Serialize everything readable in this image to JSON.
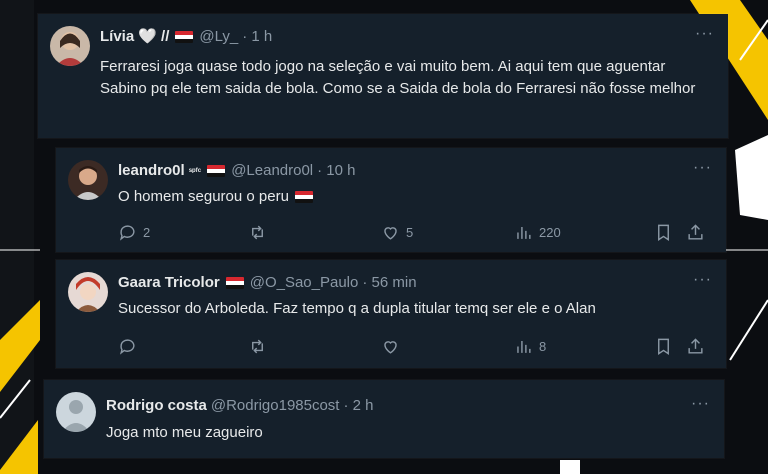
{
  "colors": {
    "card_bg": "#15202b",
    "text": "#e7e9ea",
    "muted": "#8b98a5",
    "accent_yellow": "#f5c400"
  },
  "tweets": [
    {
      "name": "Lívia",
      "name_suffix": "🤍 //",
      "handle": "@Ly_",
      "time": "· 1 h",
      "text": "Ferraresi joga quase todo jogo na seleção e vai muito bem. Ai aqui tem que aguentar Sabino pq ele tem saida de bola. Como se a Saida de bola do Ferraresi não fosse melhor",
      "more": "···",
      "avatar_icon": "person-avatar-icon"
    },
    {
      "name": "leandro0l",
      "name_suffix": "ˢᵖᶠᶜ",
      "handle": "@Leandro0l",
      "time": "· 10 h",
      "text": "O homem segurou o peru",
      "more": "···",
      "replies": "2",
      "retweets": "",
      "likes": "5",
      "views": "220"
    },
    {
      "name": "Gaara Tricolor",
      "handle": "@O_Sao_Paulo",
      "time": "· 56 min",
      "text": "Sucessor do Arboleda. Faz tempo q a dupla titular temq ser ele e o Alan",
      "more": "···",
      "replies": "",
      "retweets": "",
      "likes": "",
      "views": "8"
    },
    {
      "name": "Rodrigo costa",
      "handle": "@Rodrigo1985cost",
      "time": "· 2 h",
      "text": "Joga mto meu zagueiro",
      "more": "···"
    }
  ]
}
